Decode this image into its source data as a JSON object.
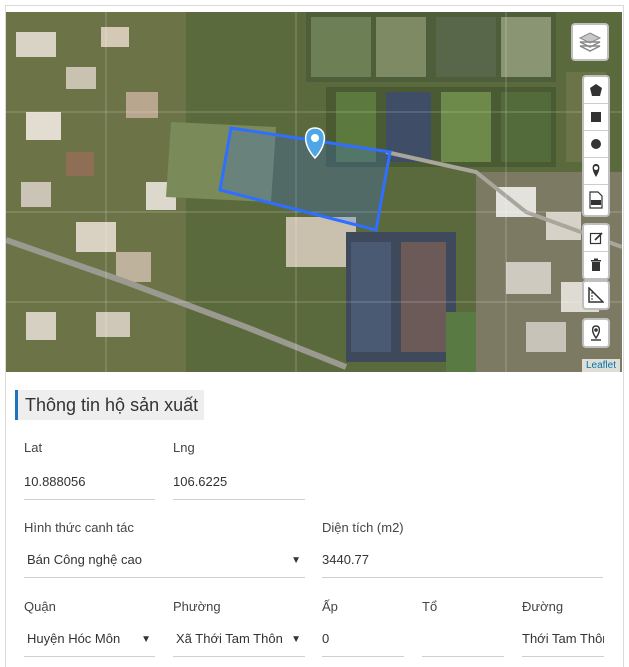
{
  "map": {
    "layers_icon": "layers-icon",
    "tools": [
      "polygon-icon",
      "rectangle-icon",
      "circle-icon",
      "marker-icon",
      "shp-file-icon",
      "edit-icon",
      "trash-icon",
      "ruler-icon",
      "locate-icon"
    ],
    "attribution": "Leaflet",
    "polygon_color": "#2f6fff",
    "marker_color": "#4ea6e6"
  },
  "section": {
    "title": "Thông tin hộ sản xuất"
  },
  "form": {
    "lat": {
      "label": "Lat",
      "value": "10.888056"
    },
    "lng": {
      "label": "Lng",
      "value": "106.6225"
    },
    "farming": {
      "label": "Hình thức canh tác",
      "value": "Bán Công nghệ cao"
    },
    "area": {
      "label": "Diện tích (m2)",
      "value": "3440.77"
    },
    "district": {
      "label": "Quận",
      "value": "Huyện Hóc Môn"
    },
    "ward": {
      "label": "Phường",
      "value": "Xã Thới Tam Thôn"
    },
    "hamlet": {
      "label": "Ấp",
      "value": "0"
    },
    "group": {
      "label": "Tổ",
      "value": ""
    },
    "street": {
      "label": "Đường",
      "value": "Thới Tam Thôn"
    }
  }
}
